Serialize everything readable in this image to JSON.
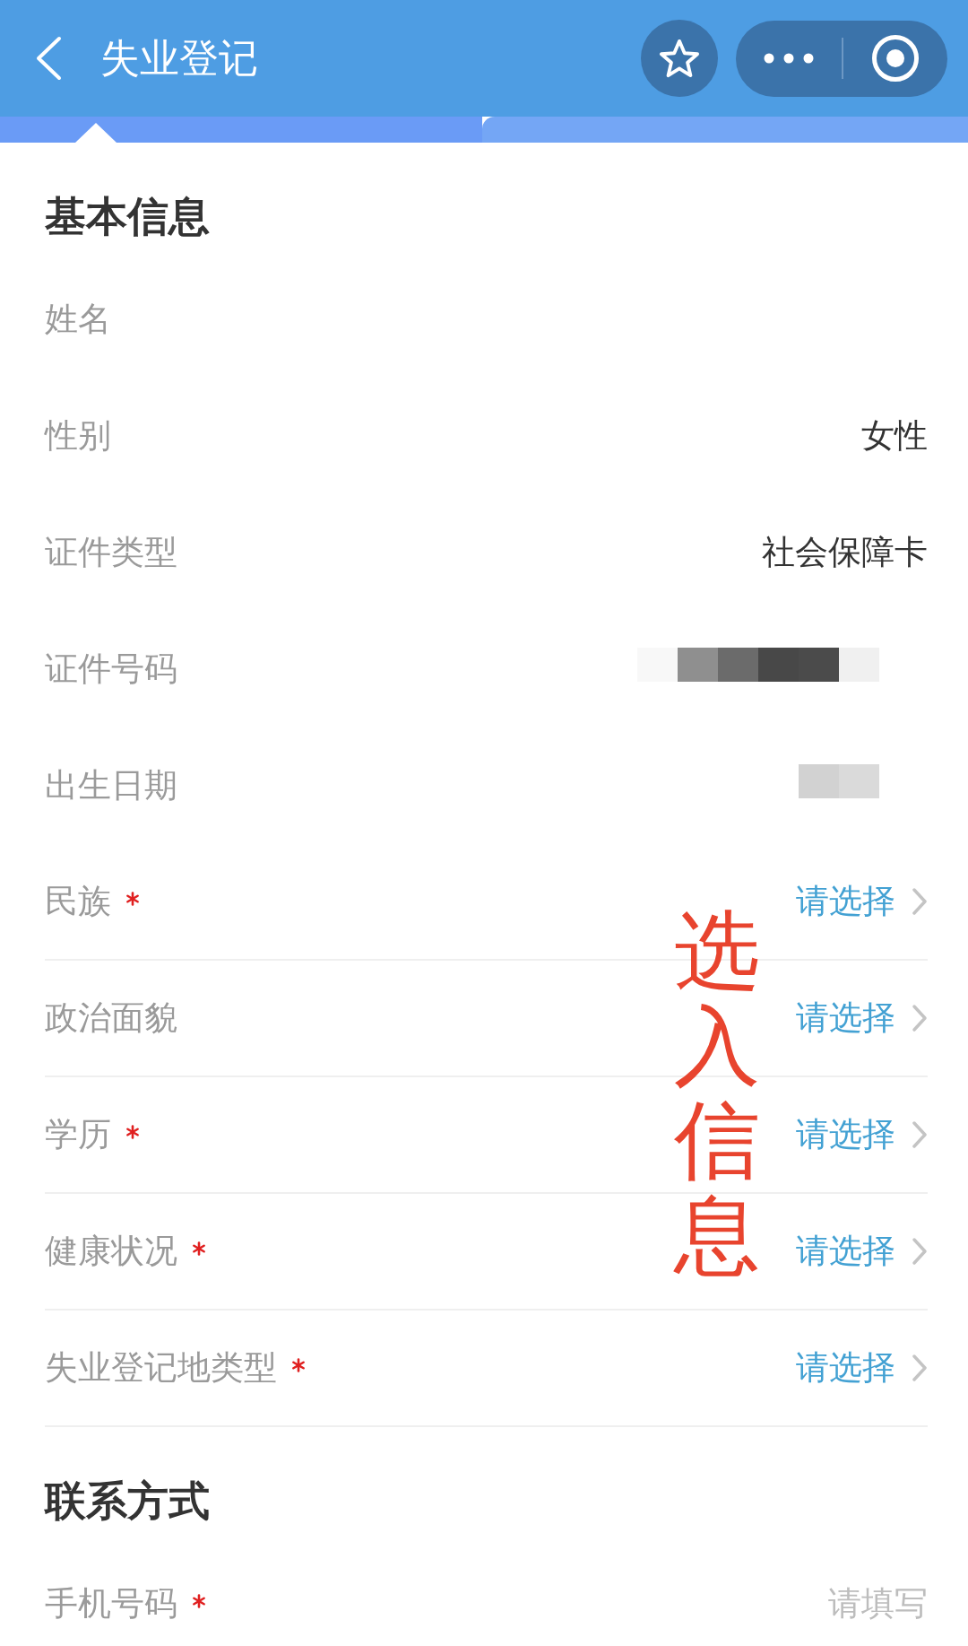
{
  "header": {
    "title": "失业登记"
  },
  "sections": [
    {
      "title": "基本信息",
      "rows": [
        {
          "kind": "text",
          "label": "姓名",
          "required": false
        },
        {
          "kind": "text",
          "label": "性别",
          "value": "女性",
          "required": false
        },
        {
          "kind": "text",
          "label": "证件类型",
          "value": "社会保障卡",
          "required": false
        },
        {
          "kind": "redacted",
          "label": "证件号码",
          "required": false
        },
        {
          "kind": "blurred",
          "label": "出生日期",
          "required": false
        },
        {
          "kind": "select",
          "label": "民族",
          "placeholder": "请选择",
          "required": true
        },
        {
          "kind": "select",
          "label": "政治面貌",
          "placeholder": "请选择",
          "required": false
        },
        {
          "kind": "select",
          "label": "学历",
          "placeholder": "请选择",
          "required": true
        },
        {
          "kind": "select",
          "label": "健康状况",
          "placeholder": "请选择",
          "required": true
        },
        {
          "kind": "select",
          "label": "失业登记地类型",
          "placeholder": "请选择",
          "required": true
        }
      ]
    },
    {
      "title": "联系方式",
      "rows": [
        {
          "kind": "input",
          "label": "手机号码",
          "placeholder": "请填写",
          "required": true
        }
      ]
    }
  ],
  "annotation": {
    "text": "选入信息"
  }
}
